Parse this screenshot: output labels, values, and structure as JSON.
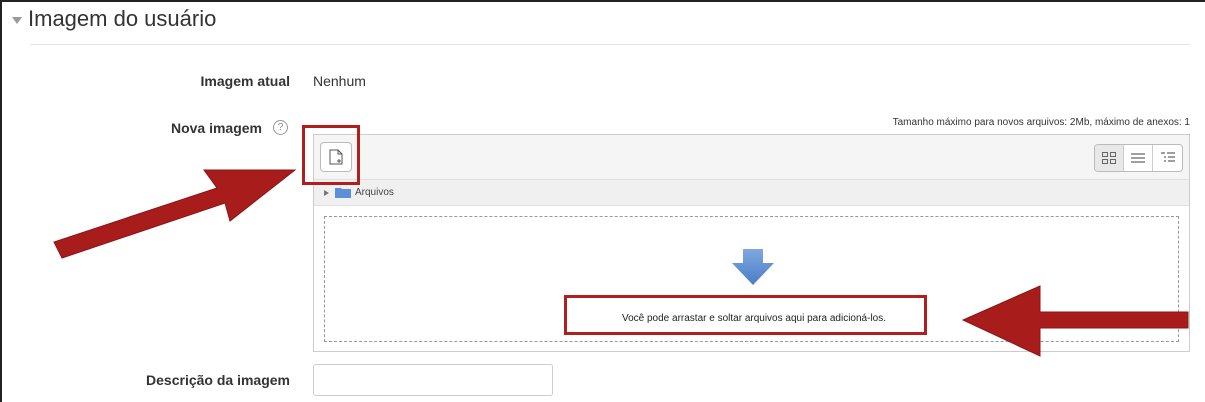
{
  "section": {
    "title": "Imagem do usuário"
  },
  "current_image": {
    "label": "Imagem atual",
    "value": "Nenhum"
  },
  "new_image": {
    "label": "Nova imagem",
    "help_glyph": "?",
    "max_size_text": "Tamanho máximo para novos arquivos: 2Mb, máximo de anexos: 1"
  },
  "filepicker": {
    "add_icon": "add-file-icon",
    "view_buttons": [
      "grid-view-icon",
      "list-view-icon",
      "tree-view-icon"
    ],
    "path_folder": "Arquivos",
    "drop_hint": "Você pode arrastar e soltar arquivos aqui para adicioná-los."
  },
  "description": {
    "label": "Descrição da imagem",
    "value": ""
  },
  "colors": {
    "annotation": "#b01e1e",
    "drop_arrow": "#5b8fd6"
  }
}
